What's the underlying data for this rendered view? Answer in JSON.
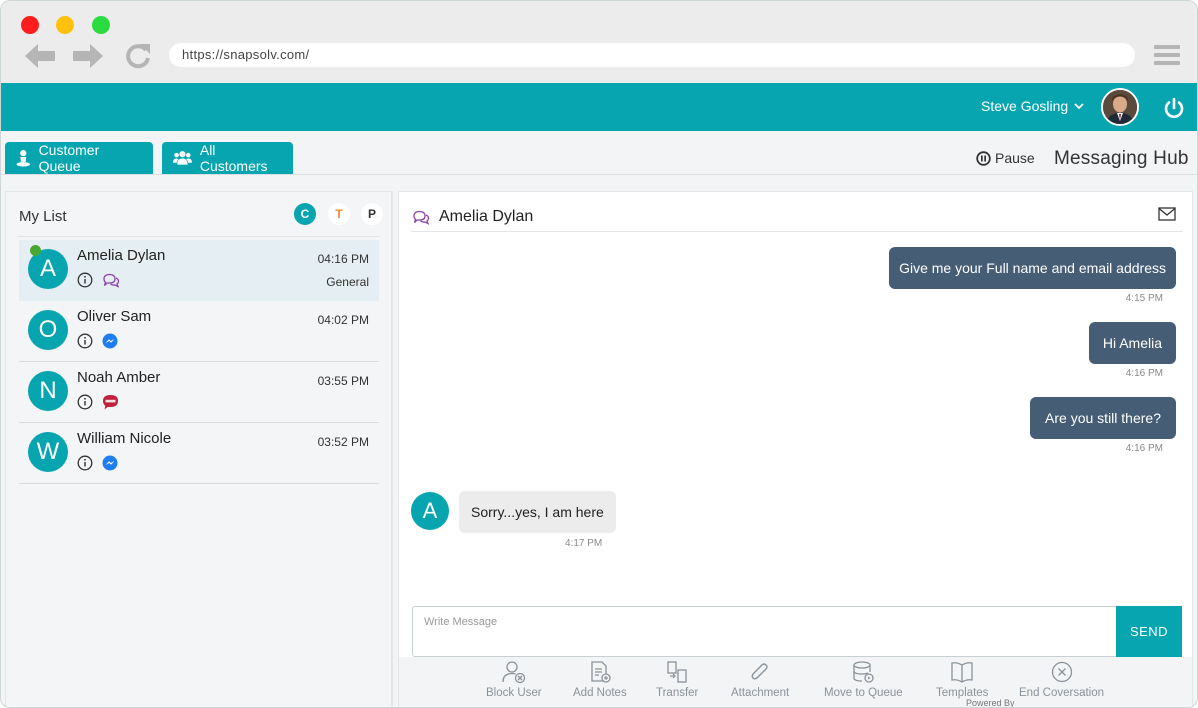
{
  "browser": {
    "url": "https://snapsolv.com/",
    "icons": [
      "back-arrow-icon",
      "forward-arrow-icon",
      "reload-icon",
      "hamburger-menu-icon"
    ]
  },
  "header": {
    "user_name": "Steve Gosling",
    "accent_color": "#06a5b0"
  },
  "tabs": {
    "customer_queue": "Customer Queue",
    "all_customers": "All Customers"
  },
  "toolbar": {
    "pause_label": "Pause",
    "hub_title": "Messaging Hub"
  },
  "sidebar": {
    "title": "My List",
    "filters": [
      "C",
      "T",
      "P"
    ],
    "items": [
      {
        "initial": "A",
        "name": "Amelia Dylan",
        "time": "04:16 PM",
        "tag": "General",
        "channel": "chat-icon",
        "online": true
      },
      {
        "initial": "O",
        "name": "Oliver Sam",
        "time": "04:02 PM",
        "tag": "",
        "channel": "messenger-icon",
        "online": false
      },
      {
        "initial": "N",
        "name": "Noah Amber",
        "time": "03:55 PM",
        "tag": "",
        "channel": "sms-icon",
        "online": false
      },
      {
        "initial": "W",
        "name": "William Nicole",
        "time": "03:52 PM",
        "tag": "",
        "channel": "messenger-icon",
        "online": false
      }
    ]
  },
  "conversation": {
    "contact_name": "Amelia Dylan",
    "messages": [
      {
        "direction": "out",
        "text": "Give me your Full name and email address",
        "time": "4:15 PM"
      },
      {
        "direction": "out",
        "text": "Hi Amelia",
        "time": "4:16 PM"
      },
      {
        "direction": "out",
        "text": "Are you still there?",
        "time": "4:16 PM"
      },
      {
        "direction": "in",
        "initial": "A",
        "text": "Sorry...yes, I am here",
        "time": "4:17 PM"
      }
    ],
    "compose_placeholder": "Write Message",
    "send_label": "SEND"
  },
  "actions": [
    {
      "label": "Block User",
      "icon": "block-user-icon"
    },
    {
      "label": "Add Notes",
      "icon": "add-notes-icon"
    },
    {
      "label": "Transfer",
      "icon": "transfer-icon"
    },
    {
      "label": "Attachment",
      "icon": "paperclip-icon"
    },
    {
      "label": "Move to Queue",
      "icon": "database-queue-icon"
    },
    {
      "label": "Templates",
      "icon": "book-icon"
    },
    {
      "label": "End Coversation",
      "icon": "close-circle-icon"
    }
  ],
  "footer": {
    "powered_by": "Powered By"
  }
}
